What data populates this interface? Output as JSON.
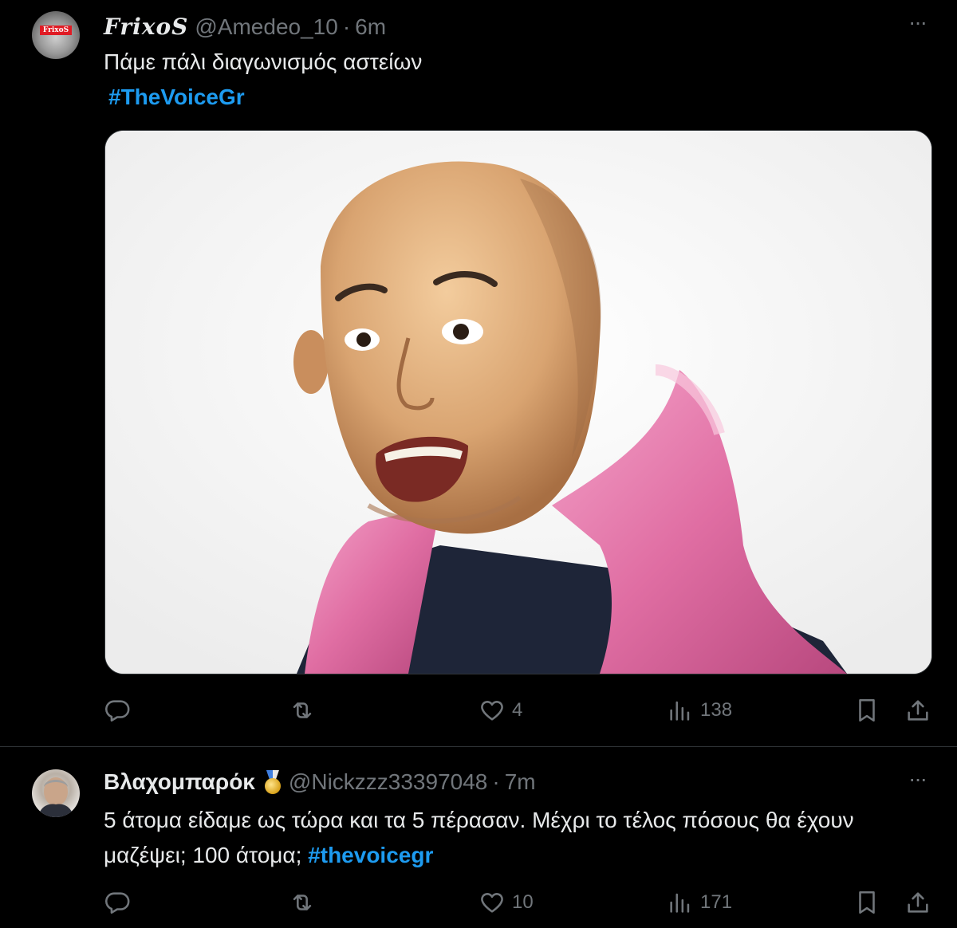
{
  "tweets": [
    {
      "avatar_badge": "FrixoS",
      "display_name": "FrixoS",
      "handle": "@Amedeo_10",
      "separator": "·",
      "time": "6m",
      "text": "Πάμε πάλι διαγωνισμός αστείων",
      "hashtag": "#TheVoiceGr",
      "media_alt": "photo",
      "actions": {
        "reply_count": "",
        "retweet_count": "",
        "like_count": "4",
        "view_count": "138"
      }
    },
    {
      "display_name": "Βλαχομπαρόκ",
      "badge_icon": "medal-icon",
      "handle": "@Nickzzz33397048",
      "separator": "·",
      "time": "7m",
      "text": "5 άτομα είδαμε ως τώρα και τα 5 πέρασαν. Μέχρι το τέλος πόσους θα έχουν μαζέψει; 100 άτομα; ",
      "hashtag": "#thevoicegr",
      "actions": {
        "reply_count": "",
        "retweet_count": "",
        "like_count": "10",
        "view_count": "171"
      }
    }
  ],
  "colors": {
    "background": "#000000",
    "text": "#e7e9ea",
    "secondary": "#71767b",
    "link": "#1d9bf0",
    "divider": "#2f3336"
  }
}
